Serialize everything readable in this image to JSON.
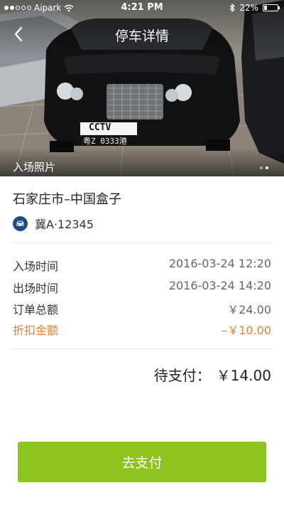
{
  "status_bar": {
    "carrier": "Aipark",
    "time": "4:21 PM",
    "battery_percent": "22%",
    "battery_level": 0.22,
    "signal_strength": 2
  },
  "header": {
    "title": "停车详情",
    "photo_label": "入场照片",
    "photo_count": 2,
    "photo_active_index": 1
  },
  "photo": {
    "plate_top": "CCTV",
    "plate_bottom": "粤Z 0333港"
  },
  "parking": {
    "lot_name": "石家庄市–中国盒子",
    "plate": "冀A·12345"
  },
  "details": [
    {
      "label": "入场时间",
      "value": "2016-03-24 12:20",
      "type": "normal"
    },
    {
      "label": "出场时间",
      "value": "2016-03-24 14:20",
      "type": "normal"
    },
    {
      "label": "订单总额",
      "value": "￥24.00",
      "type": "normal"
    },
    {
      "label": "折扣金额",
      "value": "–￥10.00",
      "type": "discount"
    }
  ],
  "payment": {
    "due_label": "待支付：",
    "due_amount": "￥14.00",
    "button_label": "去支付"
  },
  "colors": {
    "accent_green": "#8fc31f",
    "discount_orange": "#ec7d2a",
    "badge_blue": "#1e4a86"
  }
}
